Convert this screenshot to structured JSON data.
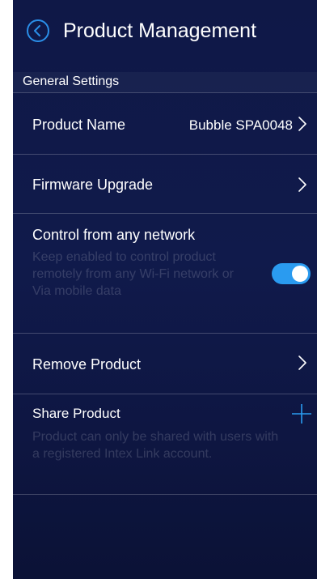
{
  "header": {
    "title": "Product Management"
  },
  "section": {
    "title": "General Settings"
  },
  "rows": {
    "product_name": {
      "label": "Product Name",
      "value": "Bubble SPA0048"
    },
    "firmware": {
      "label": "Firmware Upgrade"
    },
    "remote_control": {
      "label": "Control from any network",
      "description": "Keep enabled to control product remotely from any Wi-Fi network or Via mobile data",
      "enabled": true
    },
    "remove": {
      "label": "Remove Product"
    },
    "share": {
      "label": "Share Product",
      "description": "Product can only be shared with users with a registered Intex Link account."
    }
  },
  "icons": {
    "back": "chevron-left-circle-icon",
    "chevron": "chevron-right-icon",
    "add": "plus-icon"
  },
  "colors": {
    "background": "#0f1847",
    "accent": "#2a9bf0",
    "text": "#ffffff"
  }
}
